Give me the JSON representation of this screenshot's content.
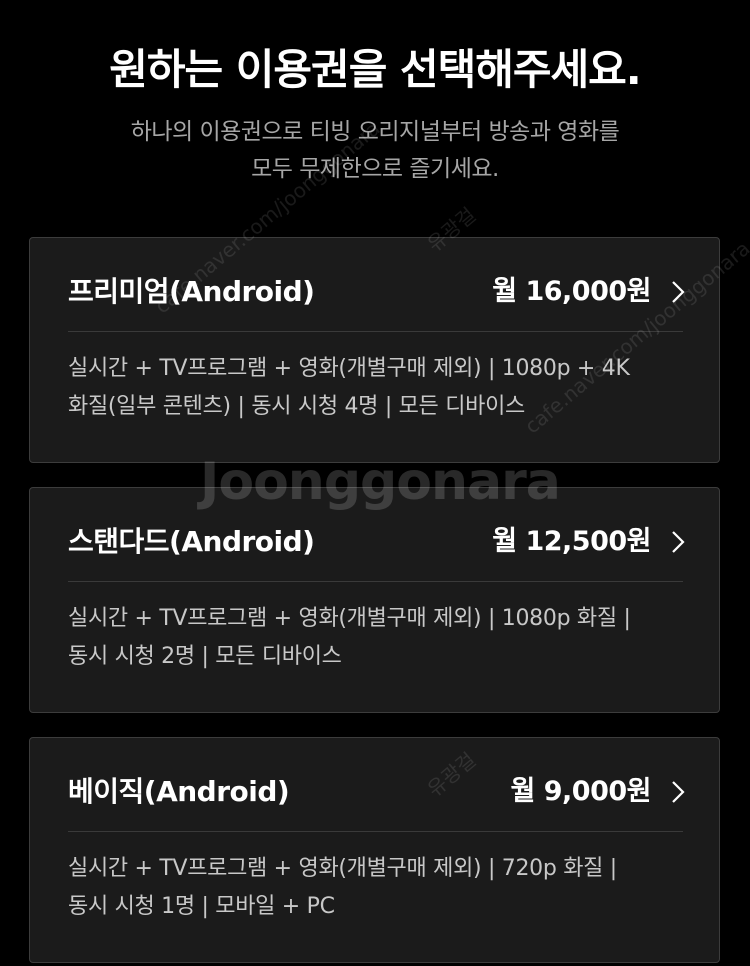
{
  "header": {
    "title": "원하는 이용권을 선택해주세요.",
    "subtitle_line1": "하나의 이용권으로 티빙 오리지널부터 방송과 영화를",
    "subtitle_line2": "모두 무제한으로 즐기세요."
  },
  "plans": [
    {
      "name": "프리미엄(Android)",
      "price": "월 16,000원",
      "desc_line1": "실시간 + TV프로그램 + 영화(개별구매 제외) | 1080p + 4K",
      "desc_line2": "화질(일부 콘텐츠) | 동시 시청 4명 | 모든 디바이스"
    },
    {
      "name": "스탠다드(Android)",
      "price": "월 12,500원",
      "desc_line1": "실시간 + TV프로그램 + 영화(개별구매 제외) | 1080p 화질 |",
      "desc_line2": "동시 시청 2명 | 모든 디바이스"
    },
    {
      "name": "베이직(Android)",
      "price": "월 9,000원",
      "desc_line1": "실시간 + TV프로그램 + 영화(개별구매 제외) | 720p 화질 |",
      "desc_line2": "동시 시청 1명 | 모바일 + PC"
    }
  ],
  "watermark": {
    "logo": "Joonggonara",
    "text": "cafe.naver.com/joonggonara",
    "seller": "유광걸"
  },
  "colors": {
    "background": "#000000",
    "card": "#1b1b1b",
    "card_border": "#3c3c3c",
    "text_primary": "#ffffff",
    "text_secondary": "#a6a6a6"
  },
  "icons": {
    "plan_arrow": "chevron-right-icon"
  }
}
